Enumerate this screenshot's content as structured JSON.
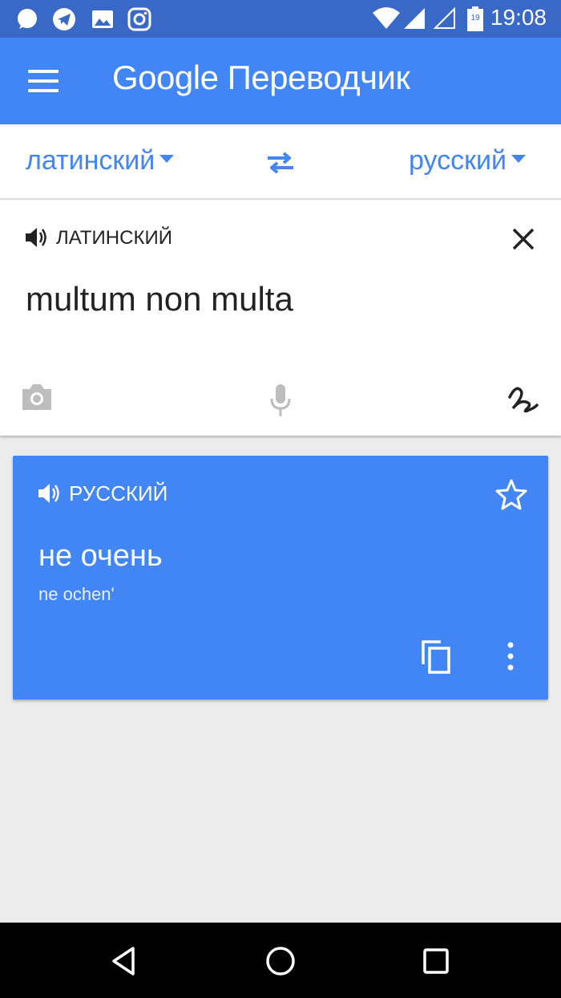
{
  "status_bar": {
    "time": "19:08",
    "battery_level": "19",
    "left_icons": [
      "chat-icon",
      "telegram-icon",
      "gallery-icon",
      "instagram-icon"
    ],
    "right_icons": [
      "wifi-icon",
      "signal-icon",
      "signal-empty-icon",
      "battery-icon"
    ]
  },
  "app_bar": {
    "title": "Google Переводчик",
    "menu_icon": "menu-icon"
  },
  "language_bar": {
    "source_language": "латинский",
    "target_language": "русский",
    "swap_icon": "swap-icon"
  },
  "input_card": {
    "label": "ЛАТИНСКИЙ",
    "text": "multum non multa",
    "icons": [
      "speaker-icon",
      "close-icon",
      "camera-icon",
      "mic-icon",
      "handwriting-icon"
    ]
  },
  "result_card": {
    "label": "РУССКИЙ",
    "translation": "не очень",
    "transliteration": "ne ochen'",
    "icons": [
      "speaker-icon",
      "star-icon",
      "copy-icon",
      "more-icon"
    ]
  },
  "colors": {
    "status_bar": "#3a68c7",
    "app_bar": "#4285f4",
    "accent": "#4285f4",
    "background": "#ececec"
  },
  "nav_bar": {
    "icons": [
      "back-icon",
      "home-icon",
      "recents-icon"
    ]
  }
}
